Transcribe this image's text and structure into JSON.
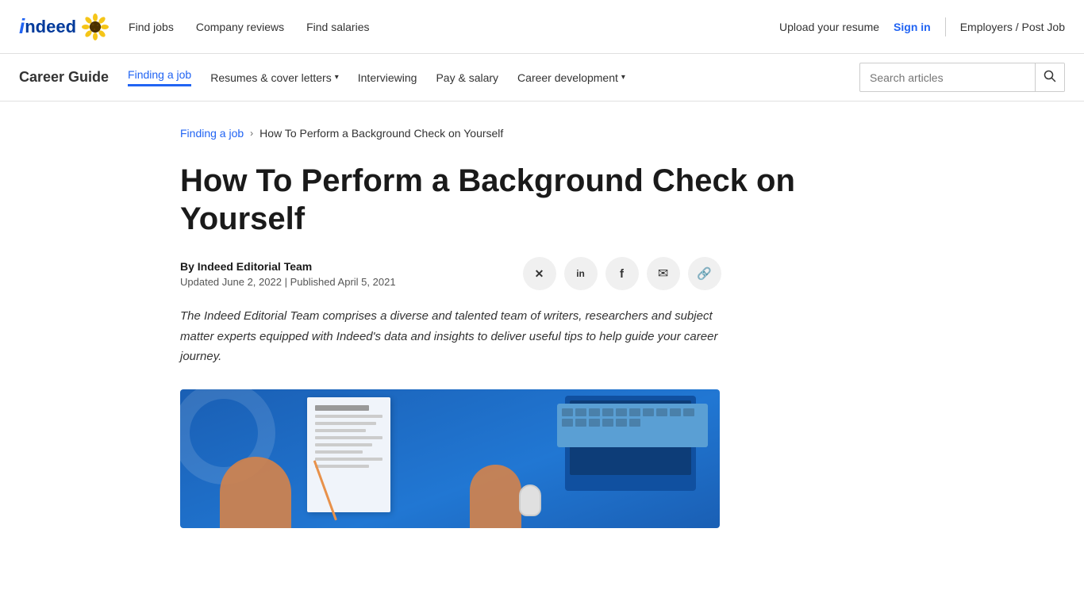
{
  "top_nav": {
    "logo_text": "indeed",
    "links": [
      {
        "label": "Find jobs",
        "id": "find-jobs"
      },
      {
        "label": "Company reviews",
        "id": "company-reviews"
      },
      {
        "label": "Find salaries",
        "id": "find-salaries"
      }
    ],
    "right": {
      "upload_resume": "Upload your resume",
      "sign_in": "Sign in",
      "employers": "Employers / Post Job"
    }
  },
  "career_nav": {
    "title": "Career Guide",
    "links": [
      {
        "label": "Finding a job",
        "id": "finding-a-job",
        "active": true,
        "dropdown": false
      },
      {
        "label": "Resumes & cover letters",
        "id": "resumes",
        "active": false,
        "dropdown": true
      },
      {
        "label": "Interviewing",
        "id": "interviewing",
        "active": false,
        "dropdown": false
      },
      {
        "label": "Pay & salary",
        "id": "pay-salary",
        "active": false,
        "dropdown": false
      },
      {
        "label": "Career development",
        "id": "career-dev",
        "active": false,
        "dropdown": true
      }
    ],
    "search_placeholder": "Search articles"
  },
  "breadcrumb": {
    "parent_label": "Finding a job",
    "parent_href": "#",
    "current": "How To Perform a Background Check on Yourself"
  },
  "article": {
    "title": "How To Perform a Background Check on Yourself",
    "author_prefix": "By ",
    "author_name": "Indeed Editorial Team",
    "updated": "Updated June 2, 2022",
    "published": "Published April 5, 2021",
    "description": "The Indeed Editorial Team comprises a diverse and talented team of writers, researchers and subject matter experts equipped with Indeed's data and insights to deliver useful tips to help guide your career journey."
  },
  "share": {
    "buttons": [
      {
        "id": "twitter",
        "icon": "𝕏",
        "label": "Share on Twitter"
      },
      {
        "id": "linkedin",
        "icon": "in",
        "label": "Share on LinkedIn"
      },
      {
        "id": "facebook",
        "icon": "f",
        "label": "Share on Facebook"
      },
      {
        "id": "email",
        "icon": "✉",
        "label": "Share via Email"
      },
      {
        "id": "link",
        "icon": "🔗",
        "label": "Copy link"
      }
    ]
  }
}
